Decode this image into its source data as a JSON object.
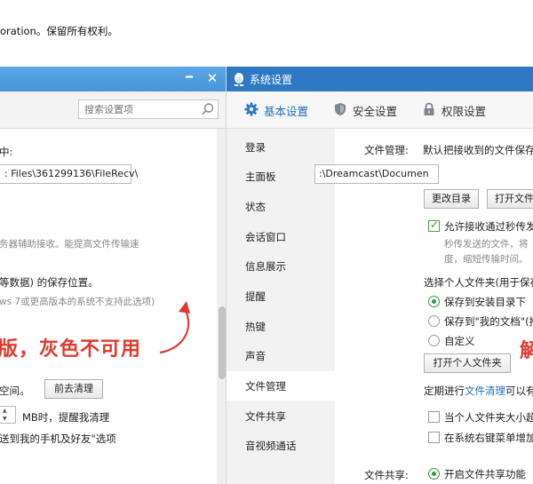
{
  "background": {
    "text": "oration。保留所有权利。"
  },
  "left_window": {
    "search_placeholder": "搜索设置项",
    "recv_label": "中:",
    "recv_path": ": Files\\361299136\\FileRecv\\",
    "server_hint": "务器辅助接收。能提高文件传输速",
    "save_location_label": "等数据) 的保存位置。",
    "win7_note": "ws 7或更高版本的系统不支持此选项)",
    "annotation": "版，灰色不可用",
    "space_label": "空间。",
    "clear_button": "前去清理",
    "threshold_label": "MB时，提醒我清理",
    "friends_option": "送到我的手机及好友\"选项"
  },
  "right_window": {
    "title": "系统设置",
    "tabs": [
      {
        "label": "基本设置",
        "icon": "gear-icon",
        "active": true
      },
      {
        "label": "安全设置",
        "icon": "shield-icon",
        "active": false
      },
      {
        "label": "权限设置",
        "icon": "lock-icon",
        "active": false
      }
    ],
    "nav": [
      {
        "label": "登录"
      },
      {
        "label": "主面板"
      },
      {
        "label": "状态"
      },
      {
        "label": "会话窗口"
      },
      {
        "label": "信息展示"
      },
      {
        "label": "提醒"
      },
      {
        "label": "热键"
      },
      {
        "label": "声音"
      },
      {
        "label": "文件管理"
      },
      {
        "label": "文件共享"
      },
      {
        "label": "音视频通话"
      }
    ],
    "file_mgmt_label": "文件管理:",
    "default_recv_text": "默认把接收到的文件保存",
    "path_value": ":\\Dreamcast\\Documen",
    "change_dir_button": "更改目录",
    "open_file_button": "打开文件",
    "allow_fast_send": "允许接收通过秒传发",
    "fast_send_desc_1": "秒传发送的文件，将",
    "fast_send_desc_2": "度，缩短传输时间。",
    "personal_folder_label": "选择个人文件夹(用于保存",
    "radio_install_dir": "保存到安装目录下",
    "radio_my_docs": "保存到\"我的文档\"(推",
    "radio_custom": "自定义",
    "open_personal_folder_button": "打开个人文件夹",
    "annotation": "解",
    "periodic_prefix": "定期进行",
    "periodic_link": "文件清理",
    "periodic_suffix": "可以有",
    "when_folder_exceeds": "当个人文件夹大小超",
    "context_menu_option": "在系统右键菜单增加",
    "file_sharing_label": "文件共享:",
    "enable_sharing": "开启文件共享功能"
  },
  "colors": {
    "title_blue": "#2f78c4",
    "accent_link": "#1e6fc0",
    "annotation_red": "#e03a2f",
    "check_green": "#2e9a39"
  }
}
